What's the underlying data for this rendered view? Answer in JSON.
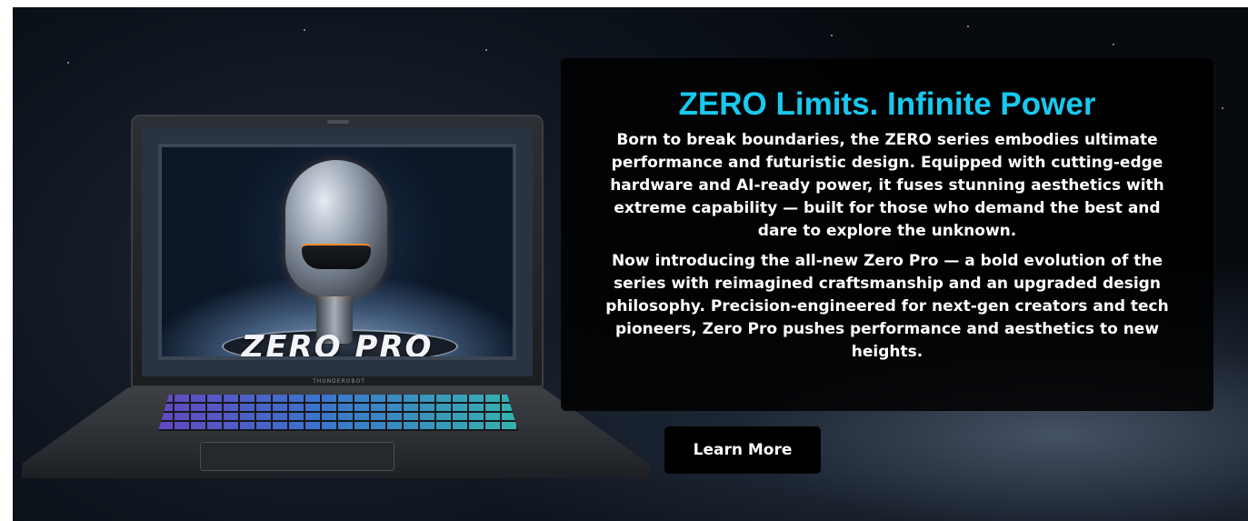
{
  "banner": {
    "headline": "ZERO Limits. Infinite Power",
    "paragraph_1": "Born to break boundaries, the ZERO series embodies ultimate performance and futuristic design. Equipped with cutting-edge hardware and AI-ready power, it fuses stunning aesthetics with extreme capability — built for those who demand the best and dare to explore the unknown.",
    "paragraph_2": "Now introducing the all-new Zero Pro — a bold evolution of the series with reimagined craftsmanship and an upgraded design philosophy. Precision-engineered for next-gen creators and tech pioneers, Zero Pro pushes performance and aesthetics to new heights.",
    "cta_label": "Learn More",
    "headline_color": "#19c8ee"
  },
  "laptop": {
    "screen_logo": "ZERO PRO",
    "hinge_brand": "THUNDEROBOT"
  }
}
